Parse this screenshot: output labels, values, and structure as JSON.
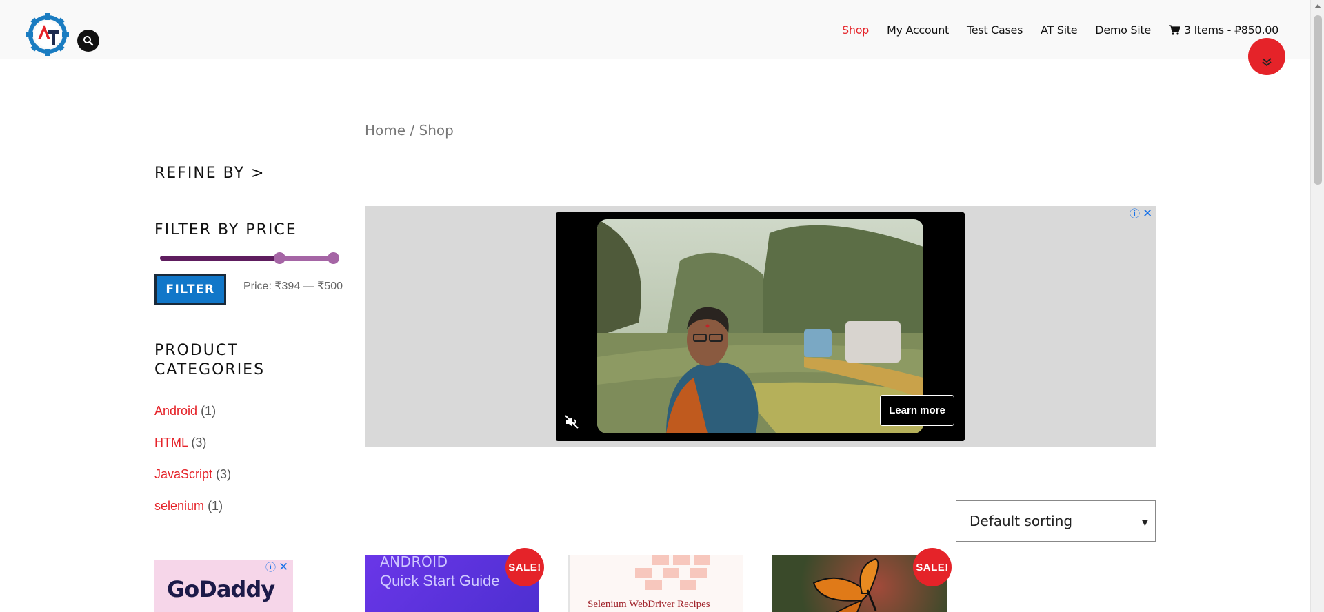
{
  "header": {
    "nav": [
      {
        "label": "Shop",
        "active": true
      },
      {
        "label": "My Account",
        "active": false
      },
      {
        "label": "Test Cases",
        "active": false
      },
      {
        "label": "AT Site",
        "active": false
      },
      {
        "label": "Demo Site",
        "active": false
      }
    ],
    "cart_label": "3 Items - ₽850.00"
  },
  "breadcrumb": "Home / Shop",
  "sidebar": {
    "refine_title": "REFINE BY >",
    "filter_title": "FILTER BY PRICE",
    "filter_button": "FILTER",
    "price_label": "Price: ₹394 — ₹500",
    "price_range_fraction": [
      0.68,
      1.0
    ],
    "categories_title": "PRODUCT CATEGORIES",
    "categories": [
      {
        "name": "Android",
        "count": "(1)"
      },
      {
        "name": "HTML",
        "count": "(3)"
      },
      {
        "name": "JavaScript",
        "count": "(3)"
      },
      {
        "name": "selenium",
        "count": "(1)"
      }
    ],
    "ad_brand": "GoDaddy"
  },
  "ad": {
    "learn_more": "Learn more"
  },
  "sorting": {
    "selected": "Default sorting"
  },
  "products": [
    {
      "image_text_1": "ANDROID",
      "image_text_2": "Quick Start Guide",
      "badge": "SALE!"
    },
    {
      "image_text_1": "Selenium WebDriver Recipes",
      "badge": ""
    },
    {
      "badge": "SALE!"
    }
  ],
  "colors": {
    "accent": "#e52329",
    "button": "#1177c9",
    "slider": "#5e1d5e"
  }
}
